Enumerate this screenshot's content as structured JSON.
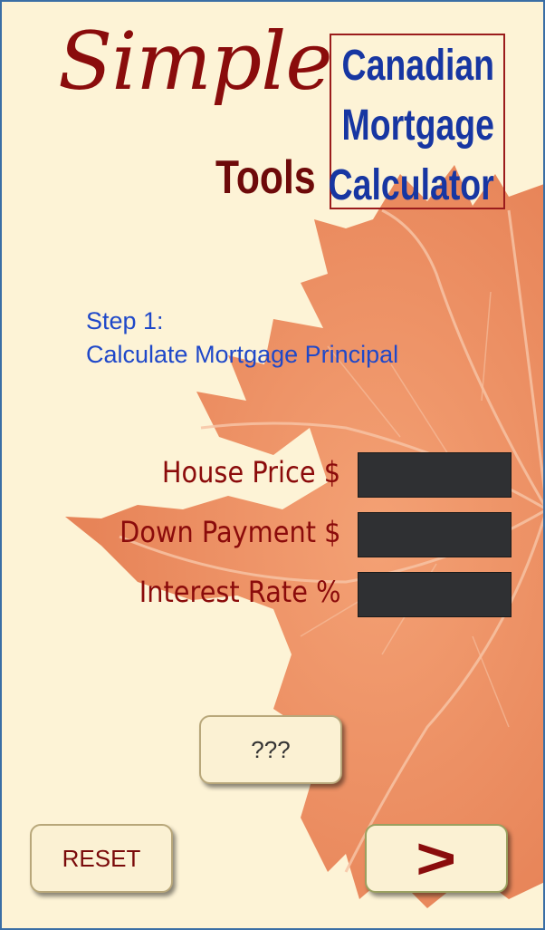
{
  "logo": {
    "simple": "Simple",
    "tools": "Tools"
  },
  "title": {
    "line1": "Canadian",
    "line2": "Mortgage",
    "line3": "Calculator"
  },
  "step": {
    "label": "Step 1:",
    "description": "Calculate Mortgage Principal"
  },
  "fields": {
    "house_price": {
      "label": "House Price $",
      "value": ""
    },
    "down_payment": {
      "label": "Down Payment $",
      "value": ""
    },
    "interest_rate": {
      "label": "Interest Rate %",
      "value": ""
    }
  },
  "buttons": {
    "help": "???",
    "reset": "RESET",
    "next": ">"
  },
  "colors": {
    "background": "#fdf3d6",
    "logo_red": "#8a0c0c",
    "title_blue": "#1736a2",
    "step_blue": "#1f48c9",
    "leaf_orange": "#ef8a5e",
    "input_dark": "#2f3033"
  },
  "icons": {
    "background": "maple-leaf"
  }
}
